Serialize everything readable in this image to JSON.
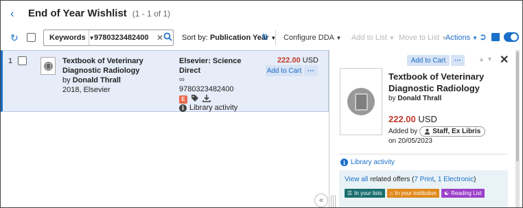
{
  "header": {
    "back_icon": "chevron-left-icon",
    "title": "End of Year Wishlist",
    "count": "(1 - 1 of 1)"
  },
  "toolbar": {
    "search_field": "Keywords",
    "search_value": "9780323482400",
    "sort_label": "Sort by:",
    "sort_value": "Publication Year",
    "configure": "Configure DDA",
    "add_to_list": "Add to List",
    "move_to_list": "Move to List",
    "actions": "Actions",
    "accent_color": "#1a6fc9"
  },
  "row": {
    "number": "1",
    "title": "Textbook of Veterinary Diagnostic Radiology",
    "by_prefix": "by",
    "author": "Donald Thrall",
    "date_publisher": "2018, Elsevier",
    "publisher": "Elsevier: Science Direct",
    "infinity": "∞",
    "isbn": "9780323482400",
    "e_badge": "E",
    "library_activity": "Library activity",
    "price_value": "222.00",
    "currency": "USD",
    "add_to_cart": "Add to Cart",
    "more": "···"
  },
  "details": {
    "add_to_cart": "Add to Cart",
    "more": "···",
    "title": "Textbook of Veterinary Diagnostic Radiology",
    "by_prefix": "by",
    "author": "Donald Thrall",
    "price_value": "222.00",
    "currency": "USD",
    "added_by_label": "Added by",
    "added_by": "Staff, Ex Libris",
    "added_on": "on 20/05/2023",
    "library_activity": "Library activity",
    "view_all": "View all",
    "related_label": "related offers (",
    "print_offers": "7 Print",
    "comma": ",",
    "electronic_offers": "1 Electronic",
    "close_paren": ")",
    "tags": [
      "In your lists",
      "In your institution",
      "Reading List"
    ],
    "price_color": "#c0392b"
  }
}
